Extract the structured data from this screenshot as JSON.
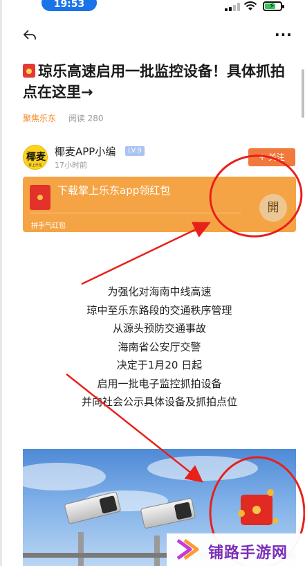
{
  "status_bar": {
    "time": "19:53"
  },
  "nav": {
    "back_icon": "back-arrow-icon",
    "more_label": "···"
  },
  "article": {
    "title": "琼乐高速启用一批监控设备！具体抓拍点在这里→",
    "source": "聚焦乐东",
    "read_label": "阅读 280",
    "paragraphs": [
      "为强化对海南中线高速",
      "琼中至乐东路段的交通秩序管理",
      "从源头预防交通事故",
      "海南省公安厅交警",
      "决定于1月20 日起",
      "启用一批电子监控抓拍设备",
      "并向社会公示具体设备及抓拍点位"
    ]
  },
  "author": {
    "avatar_text": "椰麦",
    "avatar_subtext": "掌上乐东",
    "name": "椰麦APP小编",
    "level": "LV.9",
    "time": "17小时前",
    "follow_label": "+ 关注"
  },
  "banner": {
    "title": "下载掌上乐东app领红包",
    "subtitle": "拼手气红包",
    "open_label": "開"
  },
  "watermark": {
    "text": "铺路手游网"
  },
  "colors": {
    "accent": "#f07a3c",
    "banner": "#f5a445",
    "annotation_red": "#e8201a",
    "time_pill": "#1a73e8",
    "watermark": "#7b2fb8"
  },
  "battery_level": 0.7
}
